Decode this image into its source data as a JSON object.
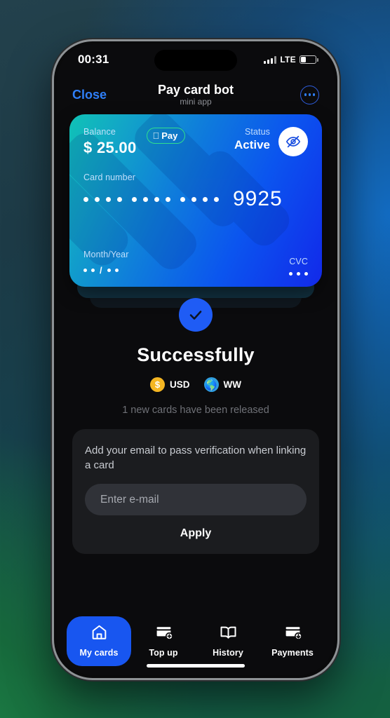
{
  "wallpaper": {
    "colors": [
      "#23414c",
      "#126ec8",
      "#1e8a4a"
    ]
  },
  "status_bar": {
    "clock": "00:31",
    "network_label": "LTE",
    "battery_percent": 30,
    "signal_icon": "cellular-signal-icon",
    "battery_icon": "battery-icon"
  },
  "app_header": {
    "close_label": "Close",
    "title": "Pay card bot",
    "subtitle": "mini app",
    "more_icon": "more-options-icon"
  },
  "card": {
    "balance_label": "Balance",
    "balance_value": "$ 25.00",
    "apple_pay_label": "Pay",
    "apple_pay_icon": "apple-logo-icon",
    "status_label": "Status",
    "status_value": "Active",
    "hide_icon": "eye-off-icon",
    "card_number_label": "Card number",
    "masked_groups": [
      4,
      4,
      4
    ],
    "last4": "9925",
    "expiry_label": "Month/Year",
    "expiry_masked": "••/••",
    "cvc_label": "CVC",
    "cvc_masked": "•••",
    "gradient": [
      "#10c3b6",
      "#0f7fda",
      "#1229ea"
    ],
    "accent_outline": "#2fe08f"
  },
  "success": {
    "check_icon": "check-circle-icon",
    "title": "Successfully",
    "badges": [
      {
        "icon": "dollar-coin-icon",
        "label": "USD",
        "color": "#f5b622"
      },
      {
        "icon": "globe-icon",
        "label": "WW",
        "color": "#2f9fe0"
      }
    ],
    "note": "1 new cards have been released"
  },
  "email_panel": {
    "description": "Add your email to pass verification when linking a card",
    "input_placeholder": "Enter e-mail",
    "input_value": "",
    "apply_label": "Apply"
  },
  "tabbar": {
    "items": [
      {
        "label": "My cards",
        "icon": "home-icon",
        "active": true
      },
      {
        "label": "Top up",
        "icon": "card-plus-icon",
        "active": false
      },
      {
        "label": "History",
        "icon": "book-icon",
        "active": false
      },
      {
        "label": "Payments",
        "icon": "card-download-icon",
        "active": false
      }
    ],
    "active_color": "#1856f0"
  }
}
